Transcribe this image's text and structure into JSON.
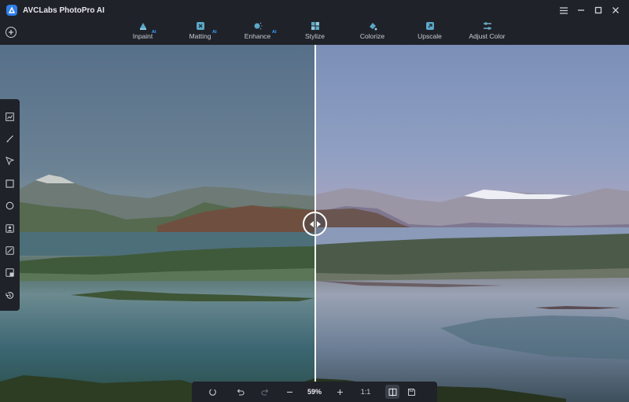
{
  "app": {
    "title": "AVCLabs PhotoPro AI"
  },
  "toolbar": {
    "items": [
      {
        "label": "Inpaint",
        "ai": "AI",
        "icon": "inpaint-icon"
      },
      {
        "label": "Matting",
        "ai": "AI",
        "icon": "matting-icon"
      },
      {
        "label": "Enhance",
        "ai": "AI",
        "icon": "enhance-icon"
      },
      {
        "label": "Stylize",
        "ai": "",
        "icon": "stylize-icon"
      },
      {
        "label": "Colorize",
        "ai": "",
        "icon": "colorize-icon"
      },
      {
        "label": "Upscale",
        "ai": "",
        "icon": "upscale-icon"
      },
      {
        "label": "Adjust Color",
        "ai": "",
        "icon": "adjust-color-icon"
      }
    ]
  },
  "sidebar": {
    "tools": [
      "stats-icon",
      "brush-icon",
      "pointer-icon",
      "rectangle-select-icon",
      "lasso-icon",
      "portrait-icon",
      "image-adjust-icon",
      "compare-icon",
      "history-icon"
    ]
  },
  "bottombar": {
    "zoom": "59%",
    "ratio": "1:1"
  },
  "colors": {
    "accent": "#2f7ee8",
    "ai_badge": "#3aa0ff",
    "chrome": "#1f2229"
  }
}
